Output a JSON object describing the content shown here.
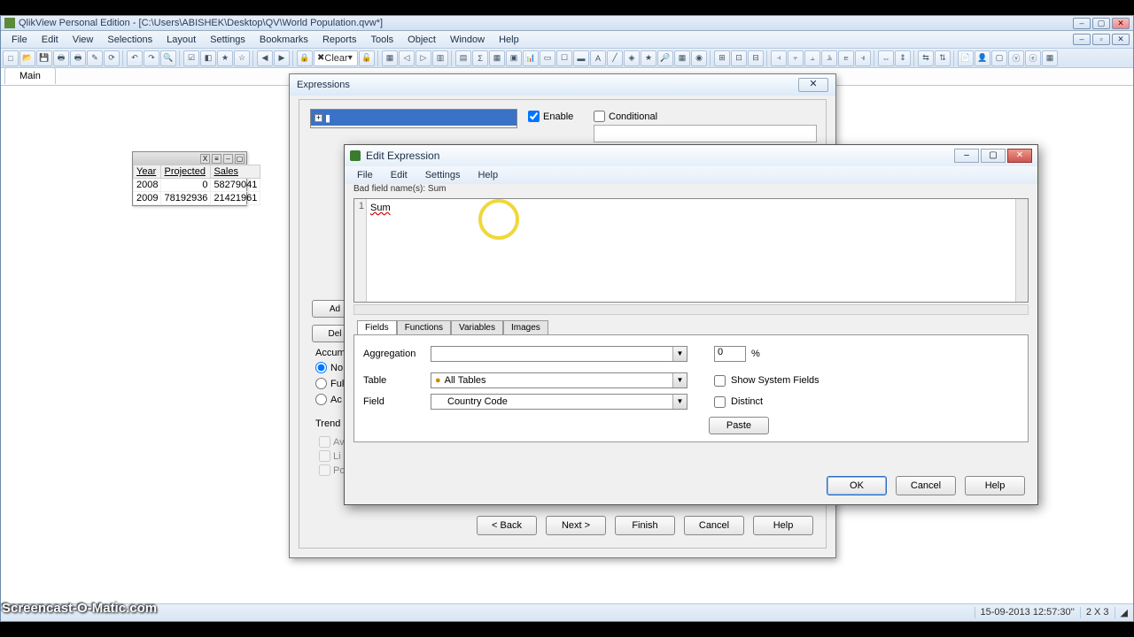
{
  "app": {
    "title": "QlikView Personal Edition - [C:\\Users\\ABISHEK\\Desktop\\QV\\World Population.qvw*]",
    "menu": [
      "File",
      "Edit",
      "View",
      "Selections",
      "Layout",
      "Settings",
      "Bookmarks",
      "Reports",
      "Tools",
      "Object",
      "Window",
      "Help"
    ],
    "clear_label": "Clear",
    "main_tab": "Main"
  },
  "float_table": {
    "headers": [
      "Year",
      "Projected",
      "Sales"
    ],
    "rows": [
      [
        "2008",
        "0",
        "58279041"
      ],
      [
        "2009",
        "78192936",
        "21421961"
      ]
    ]
  },
  "expr_dialog": {
    "title": "Expressions",
    "enable": "Enable",
    "conditional": "Conditional",
    "add": "Ad",
    "delete": "Del",
    "accum": "Accum",
    "radios": [
      "No",
      "Ful",
      "Ac"
    ],
    "trend": "Trend",
    "tchks": [
      "Av",
      "Li",
      "Po"
    ],
    "buttons": [
      "< Back",
      "Next >",
      "Finish",
      "Cancel",
      "Help"
    ]
  },
  "edit_expr": {
    "title": "Edit Expression",
    "menu": [
      "File",
      "Edit",
      "Settings",
      "Help"
    ],
    "warn": "Bad field name(s): Sum",
    "line_no": "1",
    "code": "Sum",
    "tabs": [
      "Fields",
      "Functions",
      "Variables",
      "Images"
    ],
    "aggregation_label": "Aggregation",
    "table_label": "Table",
    "field_label": "Field",
    "table_value": "All Tables",
    "field_value": "Country Code",
    "show_sysfields": "Show System Fields",
    "distinct": "Distinct",
    "paste": "Paste",
    "pct_value": "0",
    "pct_sym": "%",
    "buttons": [
      "OK",
      "Cancel",
      "Help"
    ]
  },
  "status": {
    "datetime": "15-09-2013 12:57:30''",
    "grid": "2 X 3"
  },
  "watermark": "Screencast-O-Matic.com"
}
